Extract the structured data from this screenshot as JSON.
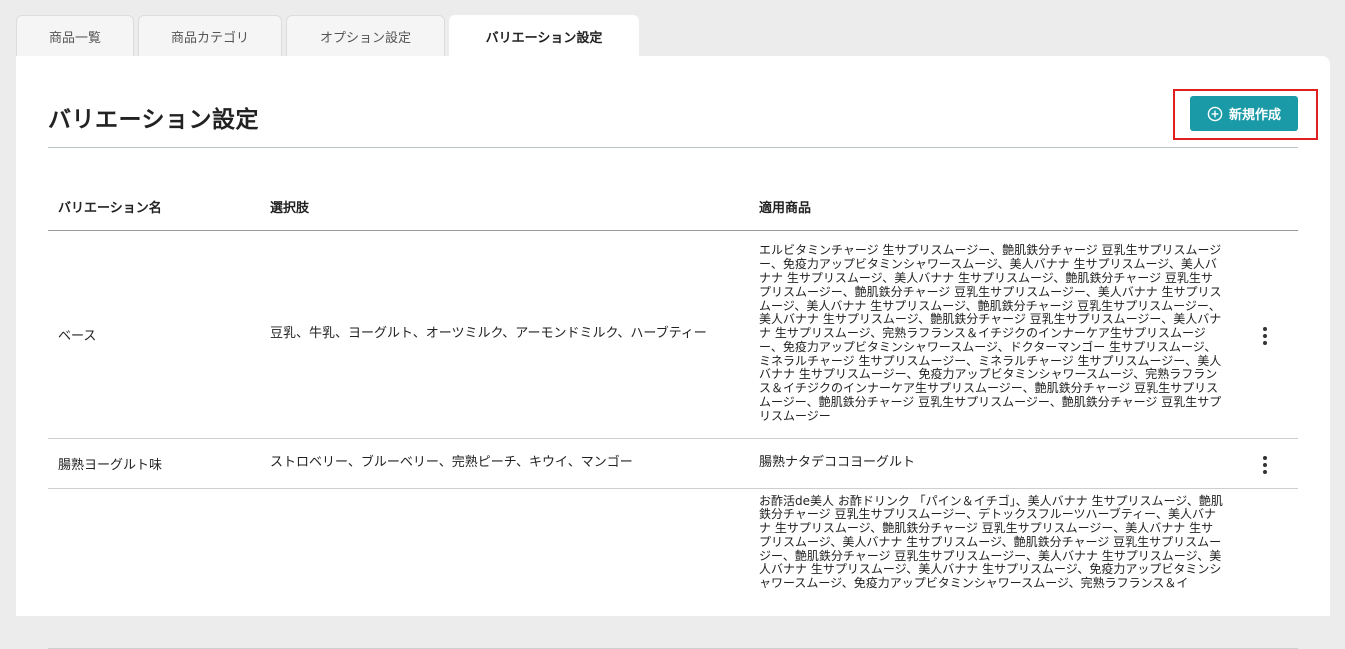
{
  "tabs": [
    {
      "label": "商品一覧",
      "active": false
    },
    {
      "label": "商品カテゴリ",
      "active": false
    },
    {
      "label": "オプション設定",
      "active": false
    },
    {
      "label": "バリエーション設定",
      "active": true
    }
  ],
  "page": {
    "title": "バリエーション設定",
    "new_button_label": "新規作成",
    "new_button_icon": "plus-circle-icon",
    "accent_color": "#1a9aa6",
    "highlight_color": "#e02020"
  },
  "table": {
    "headers": [
      "バリエーション名",
      "選択肢",
      "適用商品"
    ],
    "rows": [
      {
        "name": "ベース",
        "choices": "豆乳、牛乳、ヨーグルト、オーツミルク、アーモンドミルク、ハーブティー",
        "products": "エルビタミンチャージ 生サプリスムージー、艶肌鉄分チャージ 豆乳生サプリスムージー、免疫力アップビタミンシャワースムージ、美人バナナ 生サプリスムージ、美人バナナ 生サプリスムージ、美人バナナ 生サプリスムージ、艶肌鉄分チャージ 豆乳生サプリスムージー、艶肌鉄分チャージ 豆乳生サプリスムージー、美人バナナ 生サプリスムージ、美人バナナ 生サプリスムージ、艶肌鉄分チャージ 豆乳生サプリスムージー、美人バナナ 生サプリスムージ、艶肌鉄分チャージ 豆乳生サプリスムージー、美人バナナ 生サプリスムージ、完熟ラフランス＆イチジクのインナーケア生サプリスムージー、免疫力アップビタミンシャワースムージ、ドクターマンゴー 生サプリスムージ、ミネラルチャージ 生サプリスムージー、ミネラルチャージ 生サプリスムージー、美人バナナ 生サプリスムージー、免疫力アップビタミンシャワースムージ、完熟ラフランス＆イチジクのインナーケア生サプリスムージー、艶肌鉄分チャージ 豆乳生サプリスムージー、艶肌鉄分チャージ 豆乳生サプリスムージー、艶肌鉄分チャージ 豆乳生サプリスムージー"
      },
      {
        "name": "腸熟ヨーグルト味",
        "choices": "ストロベリー、ブルーベリー、完熟ピーチ、キウイ、マンゴー",
        "products": "腸熟ナタデココヨーグルト"
      },
      {
        "name": "",
        "choices": "",
        "products": "お酢活de美人 お酢ドリンク 「パイン＆イチゴ」、美人バナナ 生サプリスムージ、艶肌鉄分チャージ 豆乳生サプリスムージー、デトックスフルーツハーブティー、美人バナナ 生サプリスムージ、艶肌鉄分チャージ 豆乳生サプリスムージー、美人バナナ 生サプリスムージ、美人バナナ 生サプリスムージ、艶肌鉄分チャージ 豆乳生サプリスムージー、艶肌鉄分チャージ 豆乳生サプリスムージー、美人バナナ 生サプリスムージ、美人バナナ 生サプリスムージ、美人バナナ 生サプリスムージ、免疫力アップビタミンシャワースムージ、免疫力アップビタミンシャワースムージ、完熟ラフランス＆イ"
      }
    ]
  }
}
